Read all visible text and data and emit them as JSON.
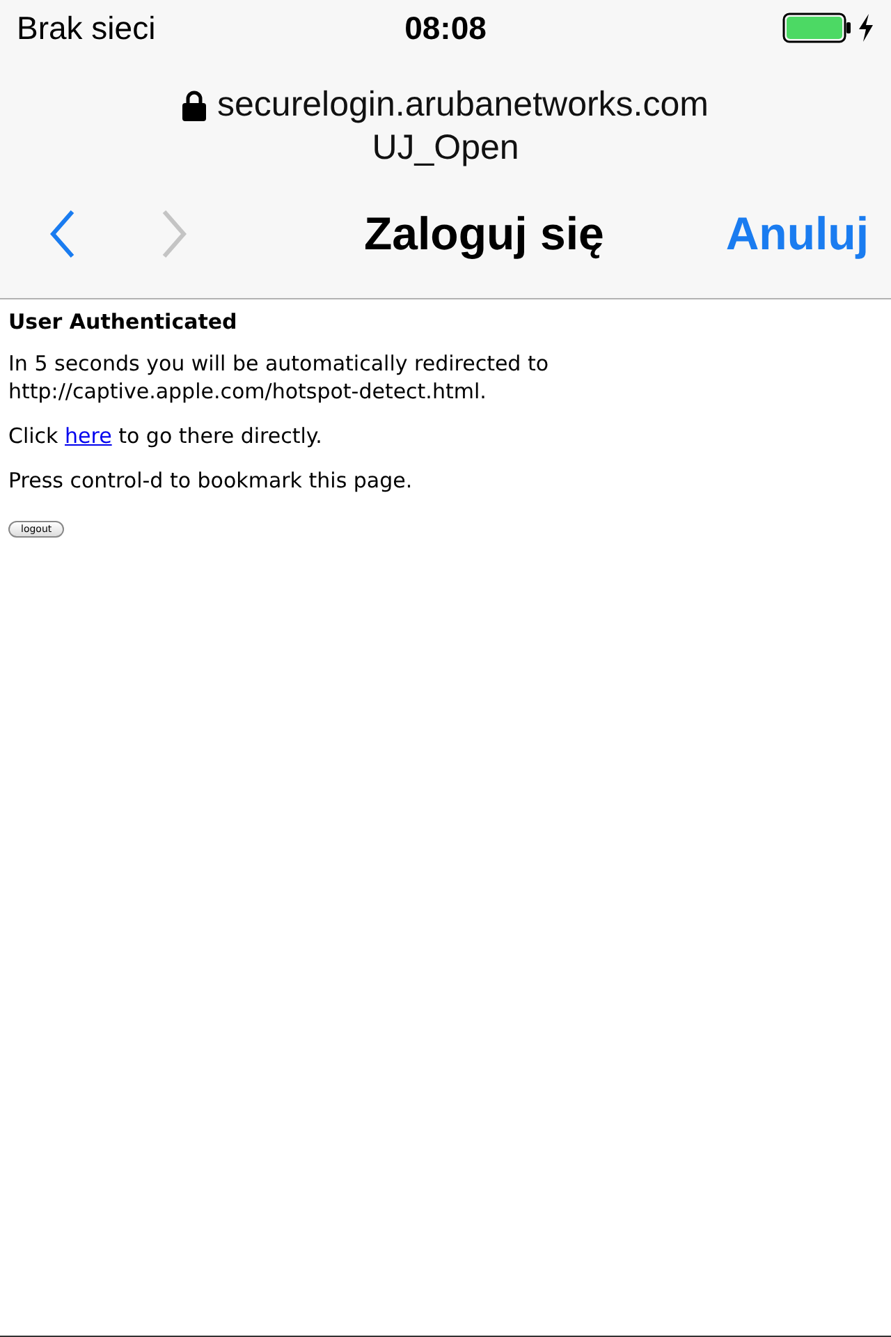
{
  "status_bar": {
    "carrier": "Brak sieci",
    "time": "08:08",
    "charging": true
  },
  "address": {
    "host": "securelogin.arubanetworks.com",
    "secure": true,
    "network": "UJ_Open"
  },
  "nav": {
    "buttons": [
      {
        "kind": "back",
        "disabled": false
      },
      {
        "kind": "forward",
        "disabled": true
      }
    ],
    "title": "Zaloguj się",
    "cancel": "Anuluj"
  },
  "content": {
    "heading": "User Authenticated",
    "lines": [
      {
        "kind": "text",
        "text": "In 5 seconds you will be automatically redirected to http://captive.apple.com/hotspot-detect.html."
      },
      {
        "kind": "link",
        "before": "Click ",
        "link": "here",
        "after": " to go there directly."
      },
      {
        "kind": "text",
        "text": "Press control-d to bookmark this page."
      }
    ],
    "button": "logout"
  }
}
